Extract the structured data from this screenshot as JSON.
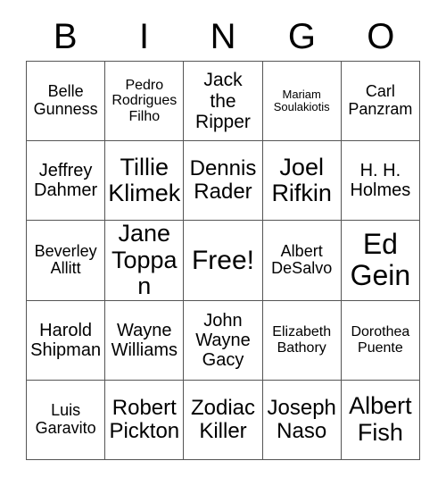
{
  "card": {
    "header_letters": [
      "B",
      "I",
      "N",
      "G",
      "O"
    ],
    "free_space_label": "Free!",
    "colors": {
      "background": "#ffffff",
      "text": "#000000",
      "grid_line": "#555555"
    },
    "rows": [
      [
        {
          "label": "Belle\nGunness",
          "size": "fs-m"
        },
        {
          "label": "Pedro\nRodrigues\nFilho",
          "size": "fs-s"
        },
        {
          "label": "Jack\nthe\nRipper",
          "size": "fs-l"
        },
        {
          "label": "Mariam\nSoulakiotis",
          "size": "fs-xs"
        },
        {
          "label": "Carl\nPanzram",
          "size": "fs-m"
        }
      ],
      [
        {
          "label": "Jeffrey\nDahmer",
          "size": "fs-ml"
        },
        {
          "label": "Tillie\nKlimek",
          "size": "fs-xxl"
        },
        {
          "label": "Dennis\nRader",
          "size": "fs-xl"
        },
        {
          "label": "Joel\nRifkin",
          "size": "fs-xxl"
        },
        {
          "label": "H. H.\nHolmes",
          "size": "fs-ml"
        }
      ],
      [
        {
          "label": "Beverley\nAllitt",
          "size": "fs-m"
        },
        {
          "label": "Jane\nToppan",
          "size": "fs-xxl"
        },
        {
          "label": "Free!",
          "size": "fs-free"
        },
        {
          "label": "Albert\nDeSalvo",
          "size": "fs-m"
        },
        {
          "label": "Ed\nGein",
          "size": "fs-huge"
        }
      ],
      [
        {
          "label": "Harold\nShipman",
          "size": "fs-ml"
        },
        {
          "label": "Wayne\nWilliams",
          "size": "fs-ml"
        },
        {
          "label": "John\nWayne\nGacy",
          "size": "fs-ml"
        },
        {
          "label": "Elizabeth\nBathory",
          "size": "fs-s"
        },
        {
          "label": "Dorothea\nPuente",
          "size": "fs-s"
        }
      ],
      [
        {
          "label": "Luis\nGaravito",
          "size": "fs-m"
        },
        {
          "label": "Robert\nPickton",
          "size": "fs-xl"
        },
        {
          "label": "Zodiac\nKiller",
          "size": "fs-xl"
        },
        {
          "label": "Joseph\nNaso",
          "size": "fs-xl"
        },
        {
          "label": "Albert\nFish",
          "size": "fs-xxl"
        }
      ]
    ]
  }
}
